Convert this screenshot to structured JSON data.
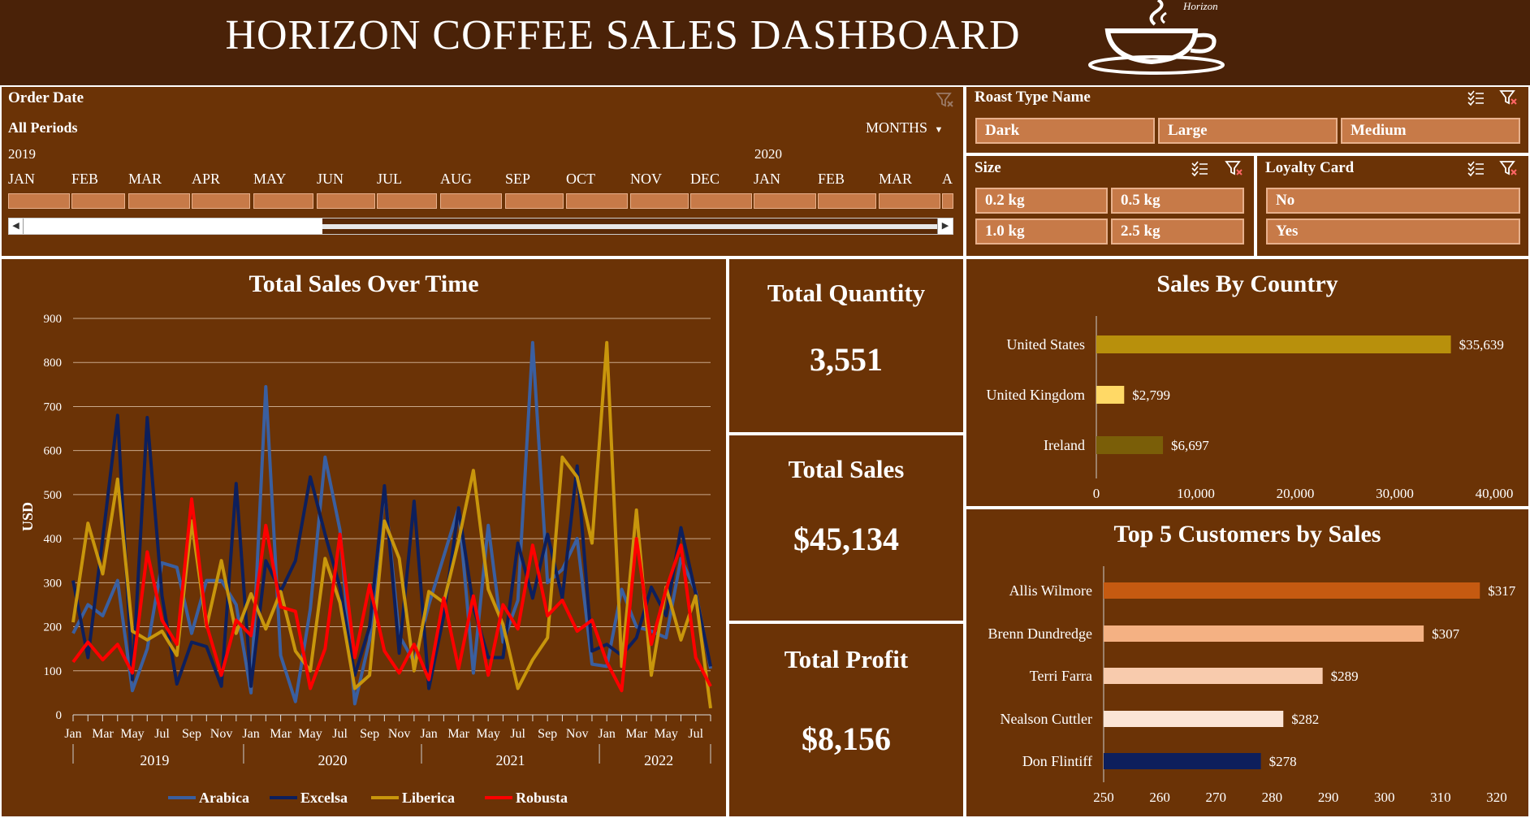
{
  "header": {
    "title": "HORIZON COFFEE SALES DASHBOARD",
    "logo_text": "Horizon"
  },
  "order_date": {
    "title": "Order Date",
    "period": "All Periods",
    "granularity": "MONTHS",
    "year_labels": [
      "2019",
      "2020"
    ],
    "months": [
      "JAN",
      "FEB",
      "MAR",
      "APR",
      "MAY",
      "JUN",
      "JUL",
      "AUG",
      "SEP",
      "OCT",
      "NOV",
      "DEC",
      "JAN",
      "FEB",
      "MAR",
      "A"
    ]
  },
  "roast_type": {
    "title": "Roast Type Name",
    "items": [
      "Dark",
      "Large",
      "Medium"
    ]
  },
  "size": {
    "title": "Size",
    "items": [
      "0.2 kg",
      "0.5 kg",
      "1.0 kg",
      "2.5 kg"
    ]
  },
  "loyalty": {
    "title": "Loyalty Card",
    "items": [
      "No",
      "Yes"
    ]
  },
  "kpis": {
    "quantity": {
      "label": "Total Quantity",
      "value": "3,551"
    },
    "sales": {
      "label": "Total Sales",
      "value": "$45,134"
    },
    "profit": {
      "label": "Total Profit",
      "value": "$8,156"
    }
  },
  "colors": {
    "arabica": "#3a5fa0",
    "excelsa": "#0d1f5c",
    "liberica": "#c8960c",
    "robusta": "#ff0000",
    "panel": "#6b3306",
    "header": "#4a2208"
  },
  "chart_data": [
    {
      "type": "line",
      "title": "Total Sales Over Time",
      "ylabel": "USD",
      "ylim": [
        0,
        900
      ],
      "yticks": [
        0,
        100,
        200,
        300,
        400,
        500,
        600,
        700,
        800,
        900
      ],
      "month_tick_labels": [
        "Jan",
        "Mar",
        "May",
        "Jul",
        "Sep",
        "Nov"
      ],
      "years": [
        "2019",
        "2020",
        "2021",
        "2022"
      ],
      "legend": "bottom",
      "series": [
        {
          "name": "Arabica",
          "color": "#3a5fa0",
          "values": [
            185,
            250,
            225,
            305,
            55,
            150,
            345,
            335,
            185,
            305,
            305,
            250,
            50,
            745,
            135,
            30,
            240,
            585,
            420,
            25,
            170,
            515,
            180,
            120,
            250,
            360,
            470,
            95,
            430,
            165,
            260,
            845,
            300,
            330,
            400,
            115,
            110,
            285,
            200,
            190,
            175,
            355,
            280,
            105
          ]
        },
        {
          "name": "Excelsa",
          "color": "#0d1f5c",
          "values": [
            305,
            130,
            400,
            680,
            80,
            675,
            270,
            70,
            165,
            155,
            65,
            525,
            65,
            350,
            280,
            350,
            540,
            410,
            290,
            90,
            200,
            520,
            140,
            485,
            60,
            225,
            470,
            245,
            130,
            130,
            390,
            265,
            410,
            265,
            565,
            145,
            160,
            135,
            175,
            290,
            225,
            425,
            275,
            110
          ]
        },
        {
          "name": "Liberica",
          "color": "#c8960c",
          "values": [
            210,
            435,
            320,
            535,
            190,
            170,
            190,
            135,
            440,
            200,
            350,
            185,
            275,
            195,
            280,
            145,
            100,
            355,
            255,
            60,
            90,
            440,
            355,
            100,
            280,
            255,
            395,
            555,
            285,
            205,
            60,
            125,
            175,
            585,
            540,
            390,
            845,
            110,
            465,
            90,
            290,
            170,
            270,
            15
          ]
        },
        {
          "name": "Robusta",
          "color": "#ff0000",
          "values": [
            120,
            165,
            125,
            160,
            95,
            370,
            215,
            160,
            490,
            205,
            90,
            215,
            180,
            430,
            245,
            235,
            60,
            150,
            410,
            130,
            295,
            145,
            95,
            160,
            80,
            265,
            105,
            270,
            90,
            250,
            195,
            385,
            225,
            260,
            190,
            215,
            120,
            55,
            400,
            160,
            285,
            385,
            130,
            65
          ]
        }
      ]
    },
    {
      "type": "bar",
      "orientation": "horizontal",
      "title": "Sales By Country",
      "categories": [
        "United States",
        "United Kingdom",
        "Ireland"
      ],
      "values": [
        35639,
        2799,
        6697
      ],
      "value_labels": [
        "$35,639",
        "$2,799",
        "$6,697"
      ],
      "colors": [
        "#b8900c",
        "#ffd966",
        "#7a5e08"
      ],
      "xlim": [
        0,
        40000
      ],
      "xticks": [
        "0",
        "10,000",
        "20,000",
        "30,000",
        "40,000"
      ]
    },
    {
      "type": "bar",
      "orientation": "horizontal",
      "title": "Top 5 Customers by Sales",
      "categories": [
        "Allis Wilmore",
        "Brenn Dundredge",
        "Terri Farra",
        "Nealson Cuttler",
        "Don Flintiff"
      ],
      "values": [
        317,
        307,
        289,
        282,
        278
      ],
      "value_labels": [
        "$317",
        "$307",
        "$289",
        "$282",
        "$278"
      ],
      "colors": [
        "#c55a11",
        "#f4b183",
        "#f8cbad",
        "#fbe5d6",
        "#0d1f5c"
      ],
      "xlim": [
        250,
        320
      ],
      "xticks": [
        "250",
        "260",
        "270",
        "280",
        "290",
        "300",
        "310",
        "320"
      ]
    }
  ]
}
